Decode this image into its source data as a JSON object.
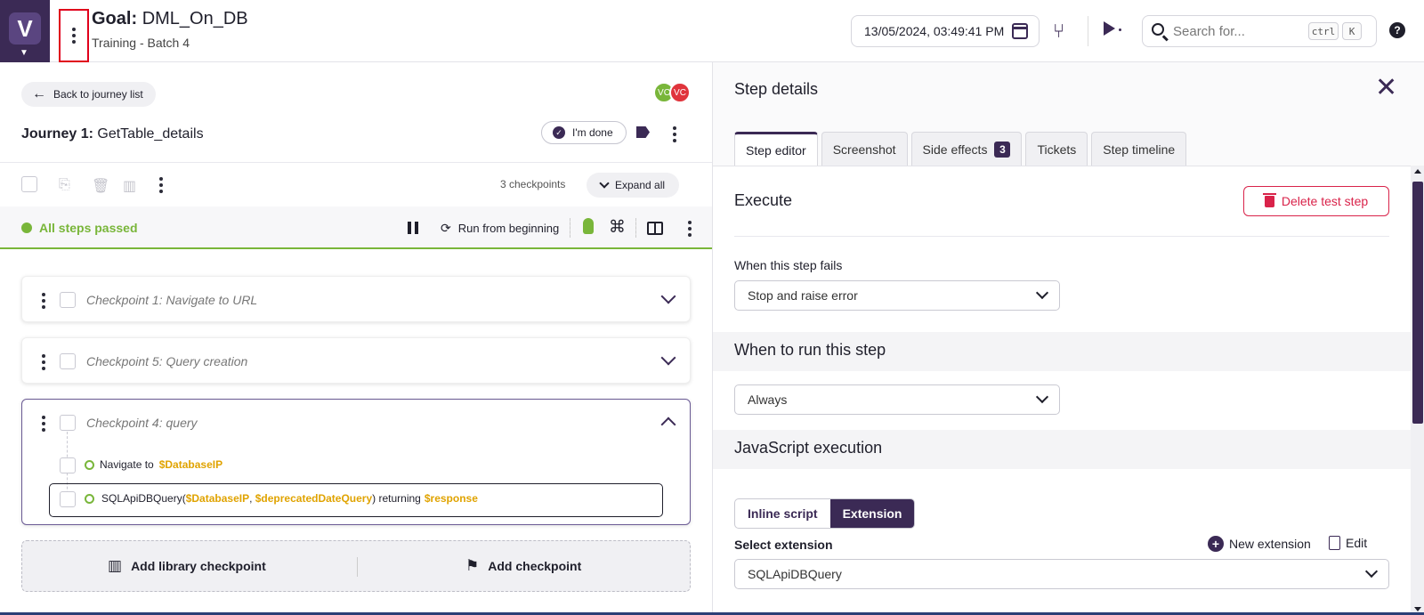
{
  "header": {
    "goal_label": "Goal:",
    "goal_name": "DML_On_DB",
    "subtitle": "Training - Batch 4",
    "datetime": "13/05/2024, 03:49:41 PM",
    "search_placeholder": "Search for...",
    "search_key1": "ctrl",
    "search_key2": "K",
    "help": "?"
  },
  "journey": {
    "back_label": "Back to journey list",
    "avatar1": "VC",
    "avatar2": "VC",
    "title_label": "Journey 1:",
    "title_name": "GetTable_details",
    "done_label": "I'm done",
    "checkpoint_count": "3 checkpoints",
    "expand_label": "Expand all",
    "status": "All steps passed",
    "run_label": "Run from beginning"
  },
  "checkpoints": [
    {
      "title": "Checkpoint 1:  Navigate to URL"
    },
    {
      "title": "Checkpoint 5:  Query creation"
    },
    {
      "title": "Checkpoint 4:  query"
    }
  ],
  "steps": {
    "step1_text": "Navigate to",
    "step1_var": "$DatabaseIP",
    "step2_fn": "SQLApiDBQuery(",
    "step2_var1": "$DatabaseIP",
    "step2_comma": ", ",
    "step2_var2": "$deprecatedDateQuery",
    "step2_mid": ") returning",
    "step2_var3": "$response"
  },
  "add": {
    "library_label": "Add library checkpoint",
    "checkpoint_label": "Add checkpoint"
  },
  "details": {
    "title": "Step details",
    "tabs": [
      {
        "label": "Step editor"
      },
      {
        "label": "Screenshot"
      },
      {
        "label": "Side effects",
        "badge": "3"
      },
      {
        "label": "Tickets"
      },
      {
        "label": "Step timeline"
      }
    ],
    "execute_heading": "Execute",
    "delete_label": "Delete test step",
    "fail_label": "When this step fails",
    "fail_value": "Stop and raise error",
    "when_heading": "When to run this step",
    "when_value": "Always",
    "js_heading": "JavaScript execution",
    "seg_inline": "Inline script",
    "seg_extension": "Extension",
    "select_ext_label": "Select extension",
    "new_ext_label": "New extension",
    "edit_label": "Edit",
    "ext_value": "SQLApiDBQuery"
  },
  "colors": {
    "brand": "#3b2a55",
    "pass": "#79b63a",
    "variable": "#e0a300",
    "danger": "#d9234a"
  }
}
